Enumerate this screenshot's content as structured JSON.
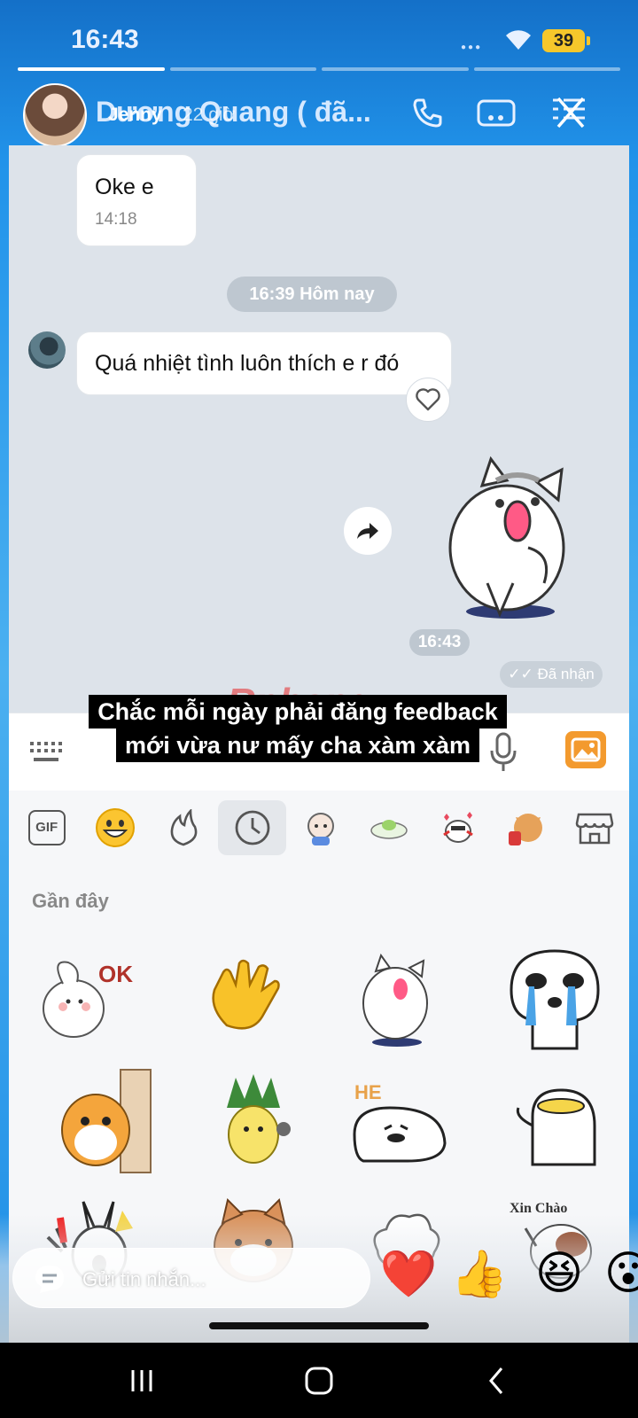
{
  "status_bar": {
    "time": "16:43",
    "battery": "39"
  },
  "story": {
    "user": "Jenny",
    "age": "22 giờ"
  },
  "chat_header": {
    "contact_name": "Dương Quang ( đã..."
  },
  "messages": [
    {
      "text": "Oke e",
      "time": "14:18"
    },
    {
      "text": "Quá nhiệt tình luôn thích e r đó"
    }
  ],
  "date_separator": "16:39 Hôm nay",
  "sticker_time": "16:43",
  "delivery_status": "✓✓ Đã nhận",
  "caption": {
    "line1": "Chắc mỗi ngày phải đăng feedback",
    "line2": "mới vừa nư mấy cha xàm xàm"
  },
  "watermark": "Rphang",
  "sticker_panel": {
    "tab_gif": "GIF",
    "recent_label": "Gần đây",
    "stickers": [
      {
        "name": "bunny-ok-sticker",
        "text": "OK"
      },
      {
        "name": "clapping-hand-sticker"
      },
      {
        "name": "cat-dance-sticker"
      },
      {
        "name": "crying-face-sticker"
      },
      {
        "name": "shiba-peek-sticker"
      },
      {
        "name": "pineapple-sticker"
      },
      {
        "name": "he-blob-sticker",
        "text": "HE"
      },
      {
        "name": "blob-yellow-sticker"
      },
      {
        "name": "bunny-shout-sticker"
      },
      {
        "name": "shiba-face-sticker"
      },
      {
        "name": "cloud-sticker"
      },
      {
        "name": "xin-chao-dog-sticker",
        "text": "Xin Chào"
      }
    ]
  },
  "reply_bar": {
    "placeholder": "Gửi tin nhắn..."
  },
  "reactions": [
    "❤️",
    "👍",
    "😆",
    "😮"
  ]
}
